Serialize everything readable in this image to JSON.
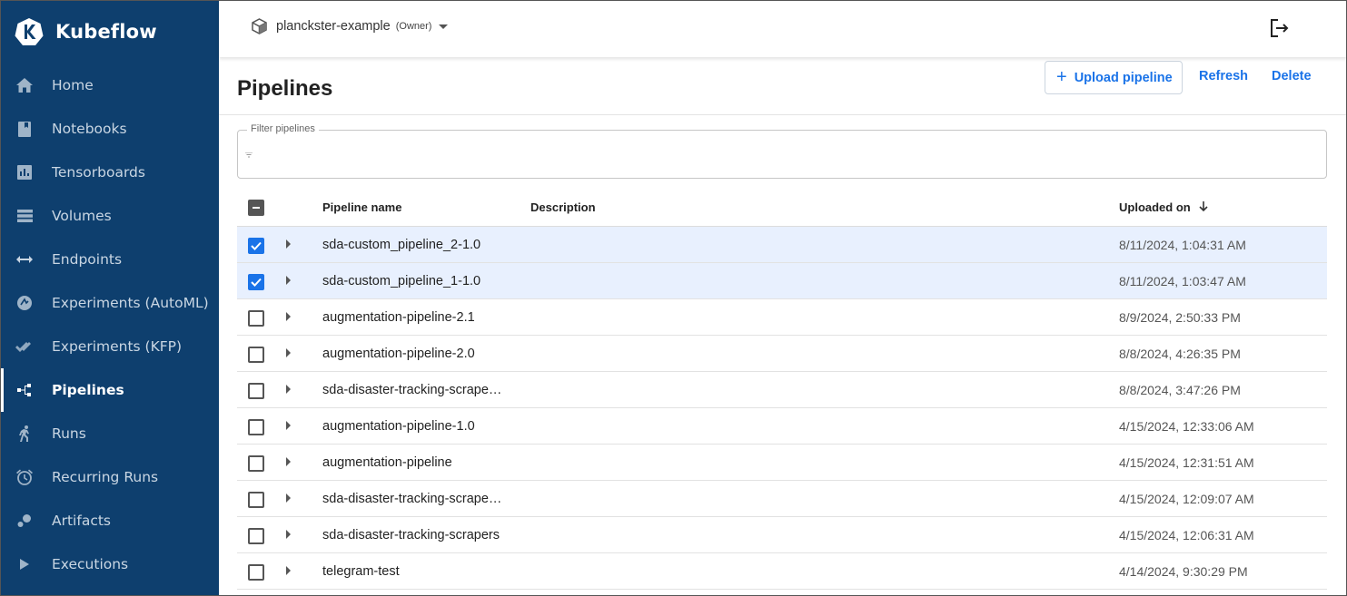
{
  "app": {
    "name": "Kubeflow"
  },
  "sidebar": {
    "items": [
      {
        "label": "Home",
        "icon": "home-icon",
        "active": false
      },
      {
        "label": "Notebooks",
        "icon": "notebook-icon",
        "active": false
      },
      {
        "label": "Tensorboards",
        "icon": "tensorboard-icon",
        "active": false
      },
      {
        "label": "Volumes",
        "icon": "volumes-icon",
        "active": false
      },
      {
        "label": "Endpoints",
        "icon": "endpoints-icon",
        "active": false
      },
      {
        "label": "Experiments (AutoML)",
        "icon": "automl-icon",
        "active": false
      },
      {
        "label": "Experiments (KFP)",
        "icon": "kfp-icon",
        "active": false
      },
      {
        "label": "Pipelines",
        "icon": "pipelines-icon",
        "active": true
      },
      {
        "label": "Runs",
        "icon": "runs-icon",
        "active": false
      },
      {
        "label": "Recurring Runs",
        "icon": "alarm-icon",
        "active": false
      },
      {
        "label": "Artifacts",
        "icon": "artifacts-icon",
        "active": false
      },
      {
        "label": "Executions",
        "icon": "play-icon",
        "active": false
      }
    ]
  },
  "topbar": {
    "namespace": "planckster-example",
    "role": "(Owner)"
  },
  "page": {
    "title": "Pipelines",
    "upload_label": "Upload pipeline",
    "refresh_label": "Refresh",
    "delete_label": "Delete"
  },
  "filter": {
    "label": "Filter pipelines",
    "value": ""
  },
  "table": {
    "columns": {
      "name": "Pipeline name",
      "description": "Description",
      "uploaded": "Uploaded on"
    },
    "sort": {
      "column": "uploaded",
      "direction": "descending"
    },
    "rows": [
      {
        "name": "sda-custom_pipeline_2-1.0",
        "description": "",
        "uploaded": "8/11/2024, 1:04:31 AM",
        "selected": true
      },
      {
        "name": "sda-custom_pipeline_1-1.0",
        "description": "",
        "uploaded": "8/11/2024, 1:03:47 AM",
        "selected": true
      },
      {
        "name": "augmentation-pipeline-2.1",
        "description": "",
        "uploaded": "8/9/2024, 2:50:33 PM",
        "selected": false
      },
      {
        "name": "augmentation-pipeline-2.0",
        "description": "",
        "uploaded": "8/8/2024, 4:26:35 PM",
        "selected": false
      },
      {
        "name": "sda-disaster-tracking-scrape…",
        "description": "",
        "uploaded": "8/8/2024, 3:47:26 PM",
        "selected": false
      },
      {
        "name": "augmentation-pipeline-1.0",
        "description": "",
        "uploaded": "4/15/2024, 12:33:06 AM",
        "selected": false
      },
      {
        "name": "augmentation-pipeline",
        "description": "",
        "uploaded": "4/15/2024, 12:31:51 AM",
        "selected": false
      },
      {
        "name": "sda-disaster-tracking-scrape…",
        "description": "",
        "uploaded": "4/15/2024, 12:09:07 AM",
        "selected": false
      },
      {
        "name": "sda-disaster-tracking-scrapers",
        "description": "",
        "uploaded": "4/15/2024, 12:06:31 AM",
        "selected": false
      },
      {
        "name": "telegram-test",
        "description": "",
        "uploaded": "4/14/2024, 9:30:29 PM",
        "selected": false
      }
    ]
  },
  "colors": {
    "sidebar_bg": "#0e3f6e",
    "accent": "#1a73e8",
    "selected_row": "#e8f0fe"
  }
}
